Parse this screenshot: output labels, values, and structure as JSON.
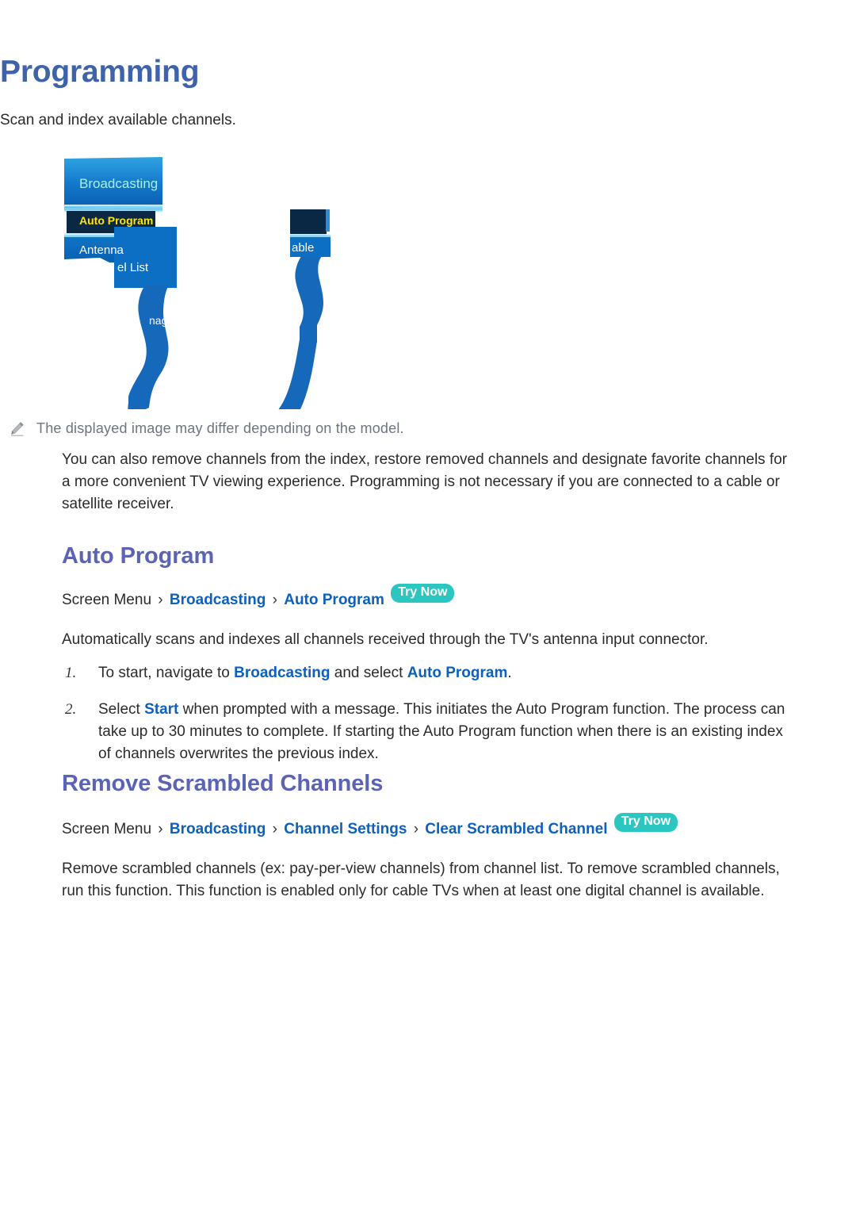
{
  "document": {
    "title": "Programming",
    "intro": "Scan and index available channels."
  },
  "figure": {
    "name": "tv-broadcasting-menu-screenshot",
    "menu_header": "Broadcasting",
    "items": [
      {
        "label": "Auto Program",
        "highlighted": true
      },
      {
        "label": "Antenna",
        "highlighted": false
      },
      {
        "label": "el List",
        "highlighted": false
      },
      {
        "label": "nager",
        "highlighted": false
      }
    ],
    "right_panel_label": "able",
    "colors": {
      "panel_blue_top": "#2e9ede",
      "panel_blue": "#0d6fc4",
      "panel_blue_deep": "#0a5fb0",
      "highlight_navy": "#0a2a4e",
      "highlight_text": "#ffe600",
      "header_text": "#a8f0e6",
      "glow": "#49c8ff",
      "cable": "#1668ba"
    }
  },
  "note": {
    "icon": "pencil-icon",
    "text": "The displayed image may differ depending on the model."
  },
  "intro_paragraph": "You can also remove channels from the index, restore removed channels and designate favorite channels for a more convenient TV viewing experience. Programming is not necessary if you are connected to a cable or satellite receiver.",
  "sections": [
    {
      "id": "auto-program",
      "title": "Auto Program",
      "breadcrumb": {
        "root": "Screen Menu",
        "separator": "›",
        "links": [
          "Broadcasting",
          "Auto Program"
        ],
        "badge": "Try Now"
      },
      "lead": "Automatically scans and indexes all channels received through the TV's antenna input connector.",
      "steps": [
        {
          "num": "1.",
          "parts": [
            {
              "t": "To start, navigate to ",
              "link": false
            },
            {
              "t": "Broadcasting",
              "link": true
            },
            {
              "t": " and select ",
              "link": false
            },
            {
              "t": "Auto Program",
              "link": true
            },
            {
              "t": ".",
              "link": false
            }
          ]
        },
        {
          "num": "2.",
          "parts": [
            {
              "t": "Select ",
              "link": false
            },
            {
              "t": "Start",
              "link": true
            },
            {
              "t": " when prompted with a message. This initiates the Auto Program function. The process can take up to 30 minutes to complete. If starting the Auto Program function when there is an existing index of channels overwrites the previous index.",
              "link": false
            }
          ]
        }
      ]
    },
    {
      "id": "remove-scrambled-channels",
      "title": "Remove Scrambled Channels",
      "breadcrumb": {
        "root": "Screen Menu",
        "separator": "›",
        "links": [
          "Broadcasting",
          "Channel Settings",
          "Clear Scrambled Channel"
        ],
        "badge": "Try Now"
      },
      "body": "Remove scrambled channels (ex: pay-per-view channels) from channel list. To remove scrambled channels, run this function. This function is enabled only for cable TVs when at least one digital channel is available."
    }
  ],
  "theme": {
    "heading_blue": "#3f63ab",
    "section_heading_blue": "#5a63b4",
    "link_blue": "#0b61bd",
    "badge_teal": "#2cc6c0",
    "body_text": "#2b2b2b",
    "note_gray": "#6d7480"
  }
}
